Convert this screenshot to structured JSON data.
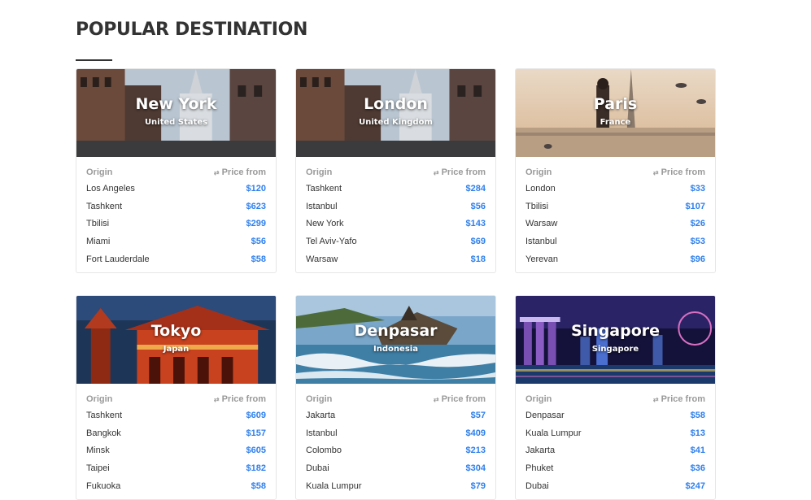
{
  "section": {
    "title": "POPULAR DESTINATION"
  },
  "table_headers": {
    "origin": "Origin",
    "price_from": "Price from",
    "swap_icon": "swap-arrows-icon"
  },
  "colors": {
    "price": "#2f80ed",
    "header_text": "#9a9a9a",
    "title": "#333333"
  },
  "destinations": [
    {
      "city": "New York",
      "country": "United States",
      "rows": [
        {
          "origin": "Los Angeles",
          "price": "$120"
        },
        {
          "origin": "Tashkent",
          "price": "$623"
        },
        {
          "origin": "Tbilisi",
          "price": "$299"
        },
        {
          "origin": "Miami",
          "price": "$56"
        },
        {
          "origin": "Fort Lauderdale",
          "price": "$58"
        }
      ]
    },
    {
      "city": "London",
      "country": "United Kingdom",
      "rows": [
        {
          "origin": "Tashkent",
          "price": "$284"
        },
        {
          "origin": "Istanbul",
          "price": "$56"
        },
        {
          "origin": "New York",
          "price": "$143"
        },
        {
          "origin": "Tel Aviv-Yafo",
          "price": "$69"
        },
        {
          "origin": "Warsaw",
          "price": "$18"
        }
      ]
    },
    {
      "city": "Paris",
      "country": "France",
      "rows": [
        {
          "origin": "London",
          "price": "$33"
        },
        {
          "origin": "Tbilisi",
          "price": "$107"
        },
        {
          "origin": "Warsaw",
          "price": "$26"
        },
        {
          "origin": "Istanbul",
          "price": "$53"
        },
        {
          "origin": "Yerevan",
          "price": "$96"
        }
      ]
    },
    {
      "city": "Tokyo",
      "country": "Japan",
      "rows": [
        {
          "origin": "Tashkent",
          "price": "$609"
        },
        {
          "origin": "Bangkok",
          "price": "$157"
        },
        {
          "origin": "Minsk",
          "price": "$605"
        },
        {
          "origin": "Taipei",
          "price": "$182"
        },
        {
          "origin": "Fukuoka",
          "price": "$58"
        }
      ]
    },
    {
      "city": "Denpasar",
      "country": "Indonesia",
      "rows": [
        {
          "origin": "Jakarta",
          "price": "$57"
        },
        {
          "origin": "Istanbul",
          "price": "$409"
        },
        {
          "origin": "Colombo",
          "price": "$213"
        },
        {
          "origin": "Dubai",
          "price": "$304"
        },
        {
          "origin": "Kuala Lumpur",
          "price": "$79"
        }
      ]
    },
    {
      "city": "Singapore",
      "country": "Singapore",
      "rows": [
        {
          "origin": "Denpasar",
          "price": "$58"
        },
        {
          "origin": "Kuala Lumpur",
          "price": "$13"
        },
        {
          "origin": "Jakarta",
          "price": "$41"
        },
        {
          "origin": "Phuket",
          "price": "$36"
        },
        {
          "origin": "Dubai",
          "price": "$247"
        }
      ]
    }
  ]
}
